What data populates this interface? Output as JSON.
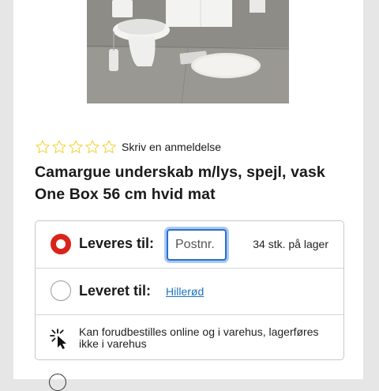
{
  "product": {
    "review_link": "Skriv en anmeldelse",
    "rating": 0,
    "max_rating": 5,
    "title_line1": "Camargue underskab m/lys, spejl, vask",
    "title_line2": "One Box 56 cm hvid mat"
  },
  "delivery": {
    "deliver_label": "Leveres til:",
    "postal_placeholder": "Postnr.",
    "stock_text": "34 stk. på lager",
    "pickup_label": "Leveret til:",
    "store_name": "Hillerød",
    "preorder_text": "Kan forudbestilles online og i varehus, lagerføres ikke i varehus"
  },
  "colors": {
    "accent_red": "#d9241b",
    "link_blue": "#1e73be",
    "focus_blue": "#2b6fd0",
    "star_outline": "#f2d64b"
  }
}
